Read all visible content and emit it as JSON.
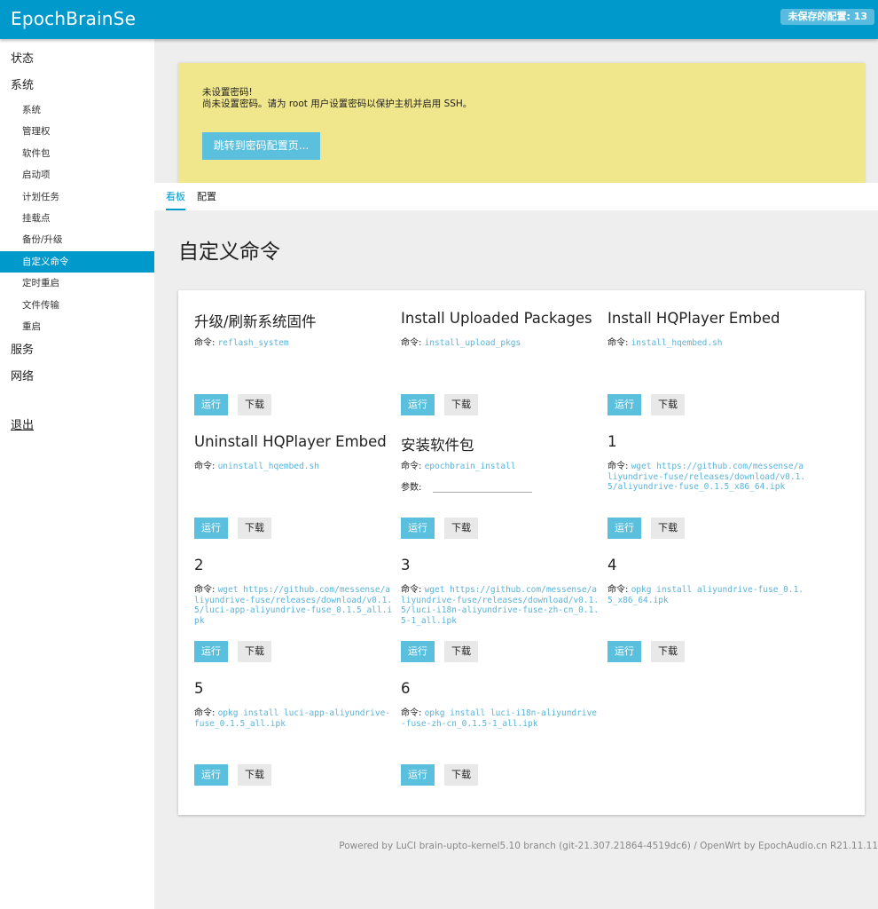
{
  "header": {
    "brand": "EpochBrainSe",
    "unsaved_label": "未保存的配置: 13"
  },
  "sidebar": {
    "status": "状态",
    "system": "系统",
    "system_items": [
      "系统",
      "管理权",
      "软件包",
      "启动项",
      "计划任务",
      "挂载点",
      "备份/升级",
      "自定义命令",
      "定时重启",
      "文件传输",
      "重启"
    ],
    "active_item": "自定义命令",
    "services": "服务",
    "network": "网络",
    "logout": "退出"
  },
  "alert": {
    "title": "未设置密码!",
    "text": "尚未设置密码。请为 root 用户设置密码以保护主机并启用 SSH。",
    "button": "跳转到密码配置页..."
  },
  "tabs": [
    "看板",
    "配置"
  ],
  "page_title": "自定义命令",
  "labels": {
    "command": "命令:",
    "params": "参数:",
    "run": "运行",
    "download": "下载"
  },
  "commands": [
    {
      "title": "升级/刷新系统固件",
      "command": "reflash_system"
    },
    {
      "title": "Install Uploaded Packages",
      "command": "install_upload_pkgs"
    },
    {
      "title": "Install HQPlayer Embed",
      "command": "install_hqembed.sh"
    },
    {
      "title": "Uninstall HQPlayer Embed",
      "command": "uninstall_hqembed.sh"
    },
    {
      "title": "安装软件包",
      "command": "epochbrain_install",
      "has_params": true
    },
    {
      "title": "1",
      "command": "wget https://github.com/messense/aliyundrive-fuse/releases/download/v0.1.5/aliyundrive-fuse_0.1.5_x86_64.ipk"
    },
    {
      "title": "2",
      "command": "wget https://github.com/messense/aliyundrive-fuse/releases/download/v0.1.5/luci-app-aliyundrive-fuse_0.1.5_all.ipk"
    },
    {
      "title": "3",
      "command": "wget https://github.com/messense/aliyundrive-fuse/releases/download/v0.1.5/luci-i18n-aliyundrive-fuse-zh-cn_0.1.5-1_all.ipk"
    },
    {
      "title": "4",
      "command": "opkg install aliyundrive-fuse_0.1.5_x86_64.ipk"
    },
    {
      "title": "5",
      "command": "opkg install luci-app-aliyundrive-fuse_0.1.5_all.ipk"
    },
    {
      "title": "6",
      "command": "opkg install luci-i18n-aliyundrive-fuse-zh-cn_0.1.5-1_all.ipk"
    }
  ],
  "footer": "Powered by LuCI brain-upto-kernel5.10 branch (git-21.307.21864-4519dc6) / OpenWrt by EpochAudio.cn R21.11.11"
}
